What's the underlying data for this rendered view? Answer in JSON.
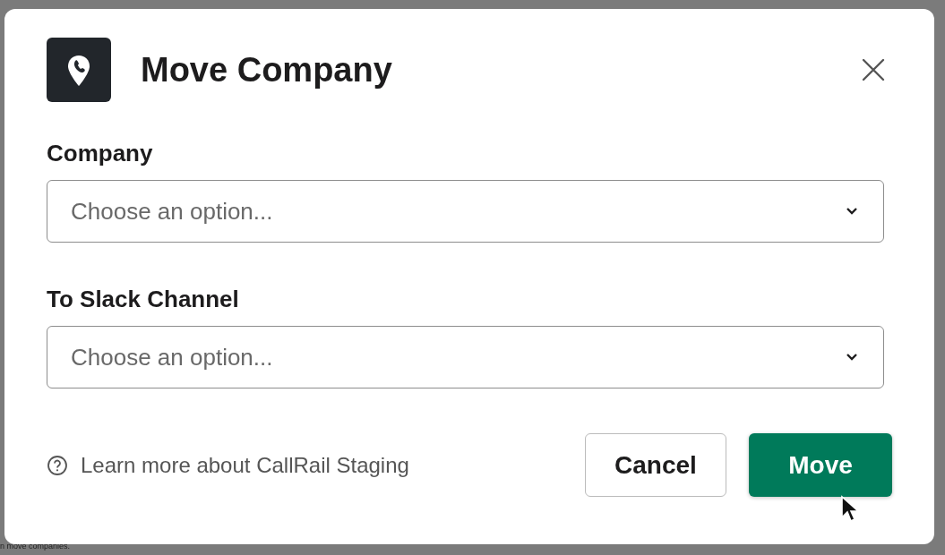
{
  "background": {
    "note": "n move companies."
  },
  "dialog": {
    "title": "Move Company",
    "fields": [
      {
        "label": "Company",
        "placeholder": "Choose an option..."
      },
      {
        "label": "To Slack Channel",
        "placeholder": "Choose an option..."
      }
    ],
    "help_link": "Learn more about CallRail Staging",
    "buttons": [
      {
        "label": "Cancel",
        "kind": "secondary"
      },
      {
        "label": "Move",
        "kind": "primary"
      }
    ]
  }
}
